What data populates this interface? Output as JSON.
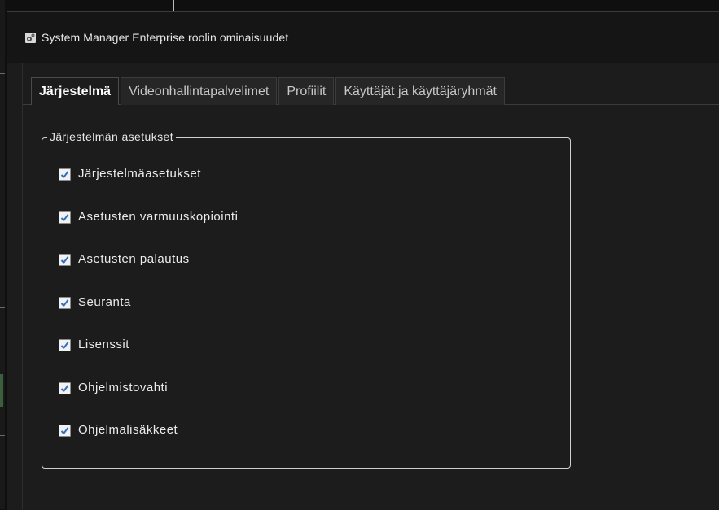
{
  "dialog": {
    "title": "System Manager Enterprise roolin ominaisuudet",
    "icon": "role-settings-icon"
  },
  "tabs": [
    {
      "label": "Järjestelmä",
      "active": true
    },
    {
      "label": "Videonhallintapalvelimet",
      "active": false
    },
    {
      "label": "Profiilit",
      "active": false
    },
    {
      "label": "Käyttäjät ja käyttäjäryhmät",
      "active": false
    }
  ],
  "group": {
    "legend": "Järjestelmän asetukset",
    "items": [
      {
        "label": "Järjestelmäasetukset",
        "checked": true
      },
      {
        "label": "Asetusten varmuuskopiointi",
        "checked": true
      },
      {
        "label": "Asetusten palautus",
        "checked": true
      },
      {
        "label": "Seuranta",
        "checked": true
      },
      {
        "label": "Lisenssit",
        "checked": true
      },
      {
        "label": "Ohjelmistovahti",
        "checked": true
      },
      {
        "label": "Ohjelmalisäkkeet",
        "checked": true
      }
    ]
  },
  "colors": {
    "background": "#1c1c1c",
    "checkmark": "#2f6fc0"
  }
}
